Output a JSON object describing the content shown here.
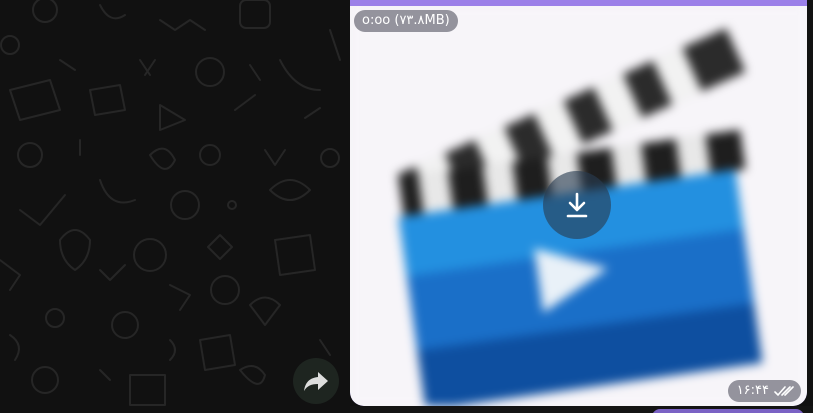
{
  "message": {
    "size_label": "o:oo (۷۳.۸MB)",
    "time": "۱۶:۴۴",
    "status_icon": "double-check-icon",
    "download_icon": "download-arrow-icon",
    "thumbnail_icon": "clapperboard-video-icon"
  },
  "actions": {
    "forward_icon": "forward-share-icon"
  },
  "colors": {
    "bubble_accent": "#9b80e8",
    "bubble": "#7a62c4",
    "background": "#111111"
  }
}
